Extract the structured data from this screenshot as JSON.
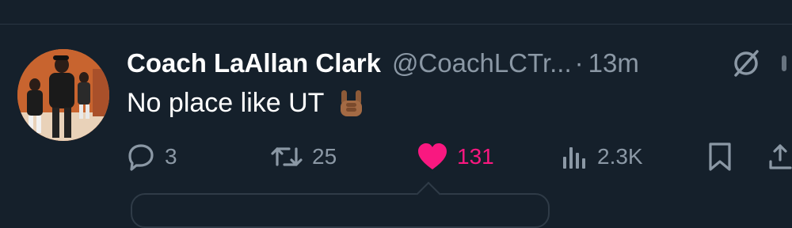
{
  "tweet": {
    "author_name": "Coach LaAllan Clark",
    "author_handle": "@CoachLCTr...",
    "separator": "·",
    "time": "13m",
    "text": "No place like UT",
    "emoji": "🤘🏾"
  },
  "actions": {
    "replies": "3",
    "retweets": "25",
    "likes": "131",
    "views": "2.3K"
  },
  "colors": {
    "background": "#15202b",
    "muted_text": "#8b98a5",
    "like_pink": "#f91880"
  },
  "icons": [
    "grok-icon",
    "reply-icon",
    "retweet-icon",
    "heart-icon",
    "views-icon",
    "bookmark-icon",
    "share-icon"
  ]
}
